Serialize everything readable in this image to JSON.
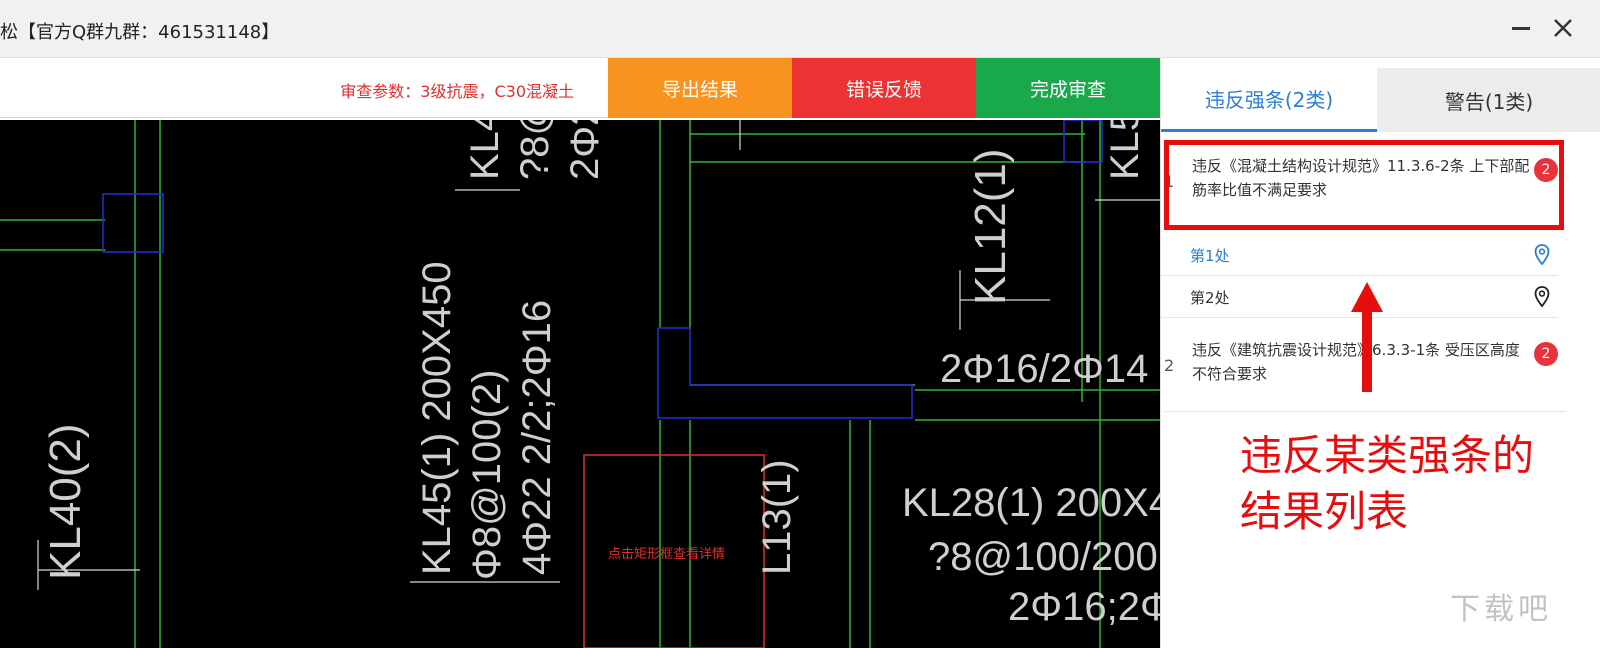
{
  "window": {
    "title": "松【官方Q群九群：461531148】",
    "minimize_icon": "minimize-icon",
    "close_icon": "close-icon"
  },
  "toolbar": {
    "params": "审查参数：3级抗震，C30混凝土",
    "export_label": "导出结果",
    "feedback_label": "错误反馈",
    "finish_label": "完成审查",
    "colors": {
      "export": "#f7931e",
      "feedback": "#ec3232",
      "finish": "#19a84a"
    }
  },
  "cad": {
    "labels": {
      "kl40": "KL40(2)",
      "kl45_1": "KL45(1) 200X450",
      "kl45_2": "Φ8@100(2)",
      "kl45_3": "4Φ22 2/2;2Φ16",
      "kl12": "KL12(1)",
      "kl4": "KL4",
      "kl4_2": "?8@",
      "kl4_3": "2Φ2",
      "kl5": "KL5",
      "mid_rebar": "2Φ16/2Φ14",
      "l13": "L13(1)",
      "kl28_1": "KL28(1) 200X4",
      "kl28_2": "?8@100/200",
      "kl28_3": "2Φ16;2Φ",
      "click_hint": "点击矩形框查看详情"
    }
  },
  "panel": {
    "tabs": [
      {
        "label": "违反强条(2类)",
        "active": true
      },
      {
        "label": "警告(1类)",
        "active": false
      }
    ],
    "rules": [
      {
        "num": "1",
        "text": "违反《混凝土结构设计规范》11.3.6-2条 上下部配筋率比值不满足要求",
        "count": "2",
        "locations": [
          {
            "label": "第1处",
            "icon": "location-pin-icon"
          },
          {
            "label": "第2处",
            "icon": "location-pin-icon"
          }
        ]
      },
      {
        "num": "2",
        "text": "违反《建筑抗震设计规范》6.3.3-1条 受压区高度不符合要求",
        "count": "2"
      }
    ]
  },
  "annotation": {
    "text_line1": "违反某类强条的",
    "text_line2": "结果列表",
    "color": "#e50d0d"
  },
  "watermark": "下载吧"
}
